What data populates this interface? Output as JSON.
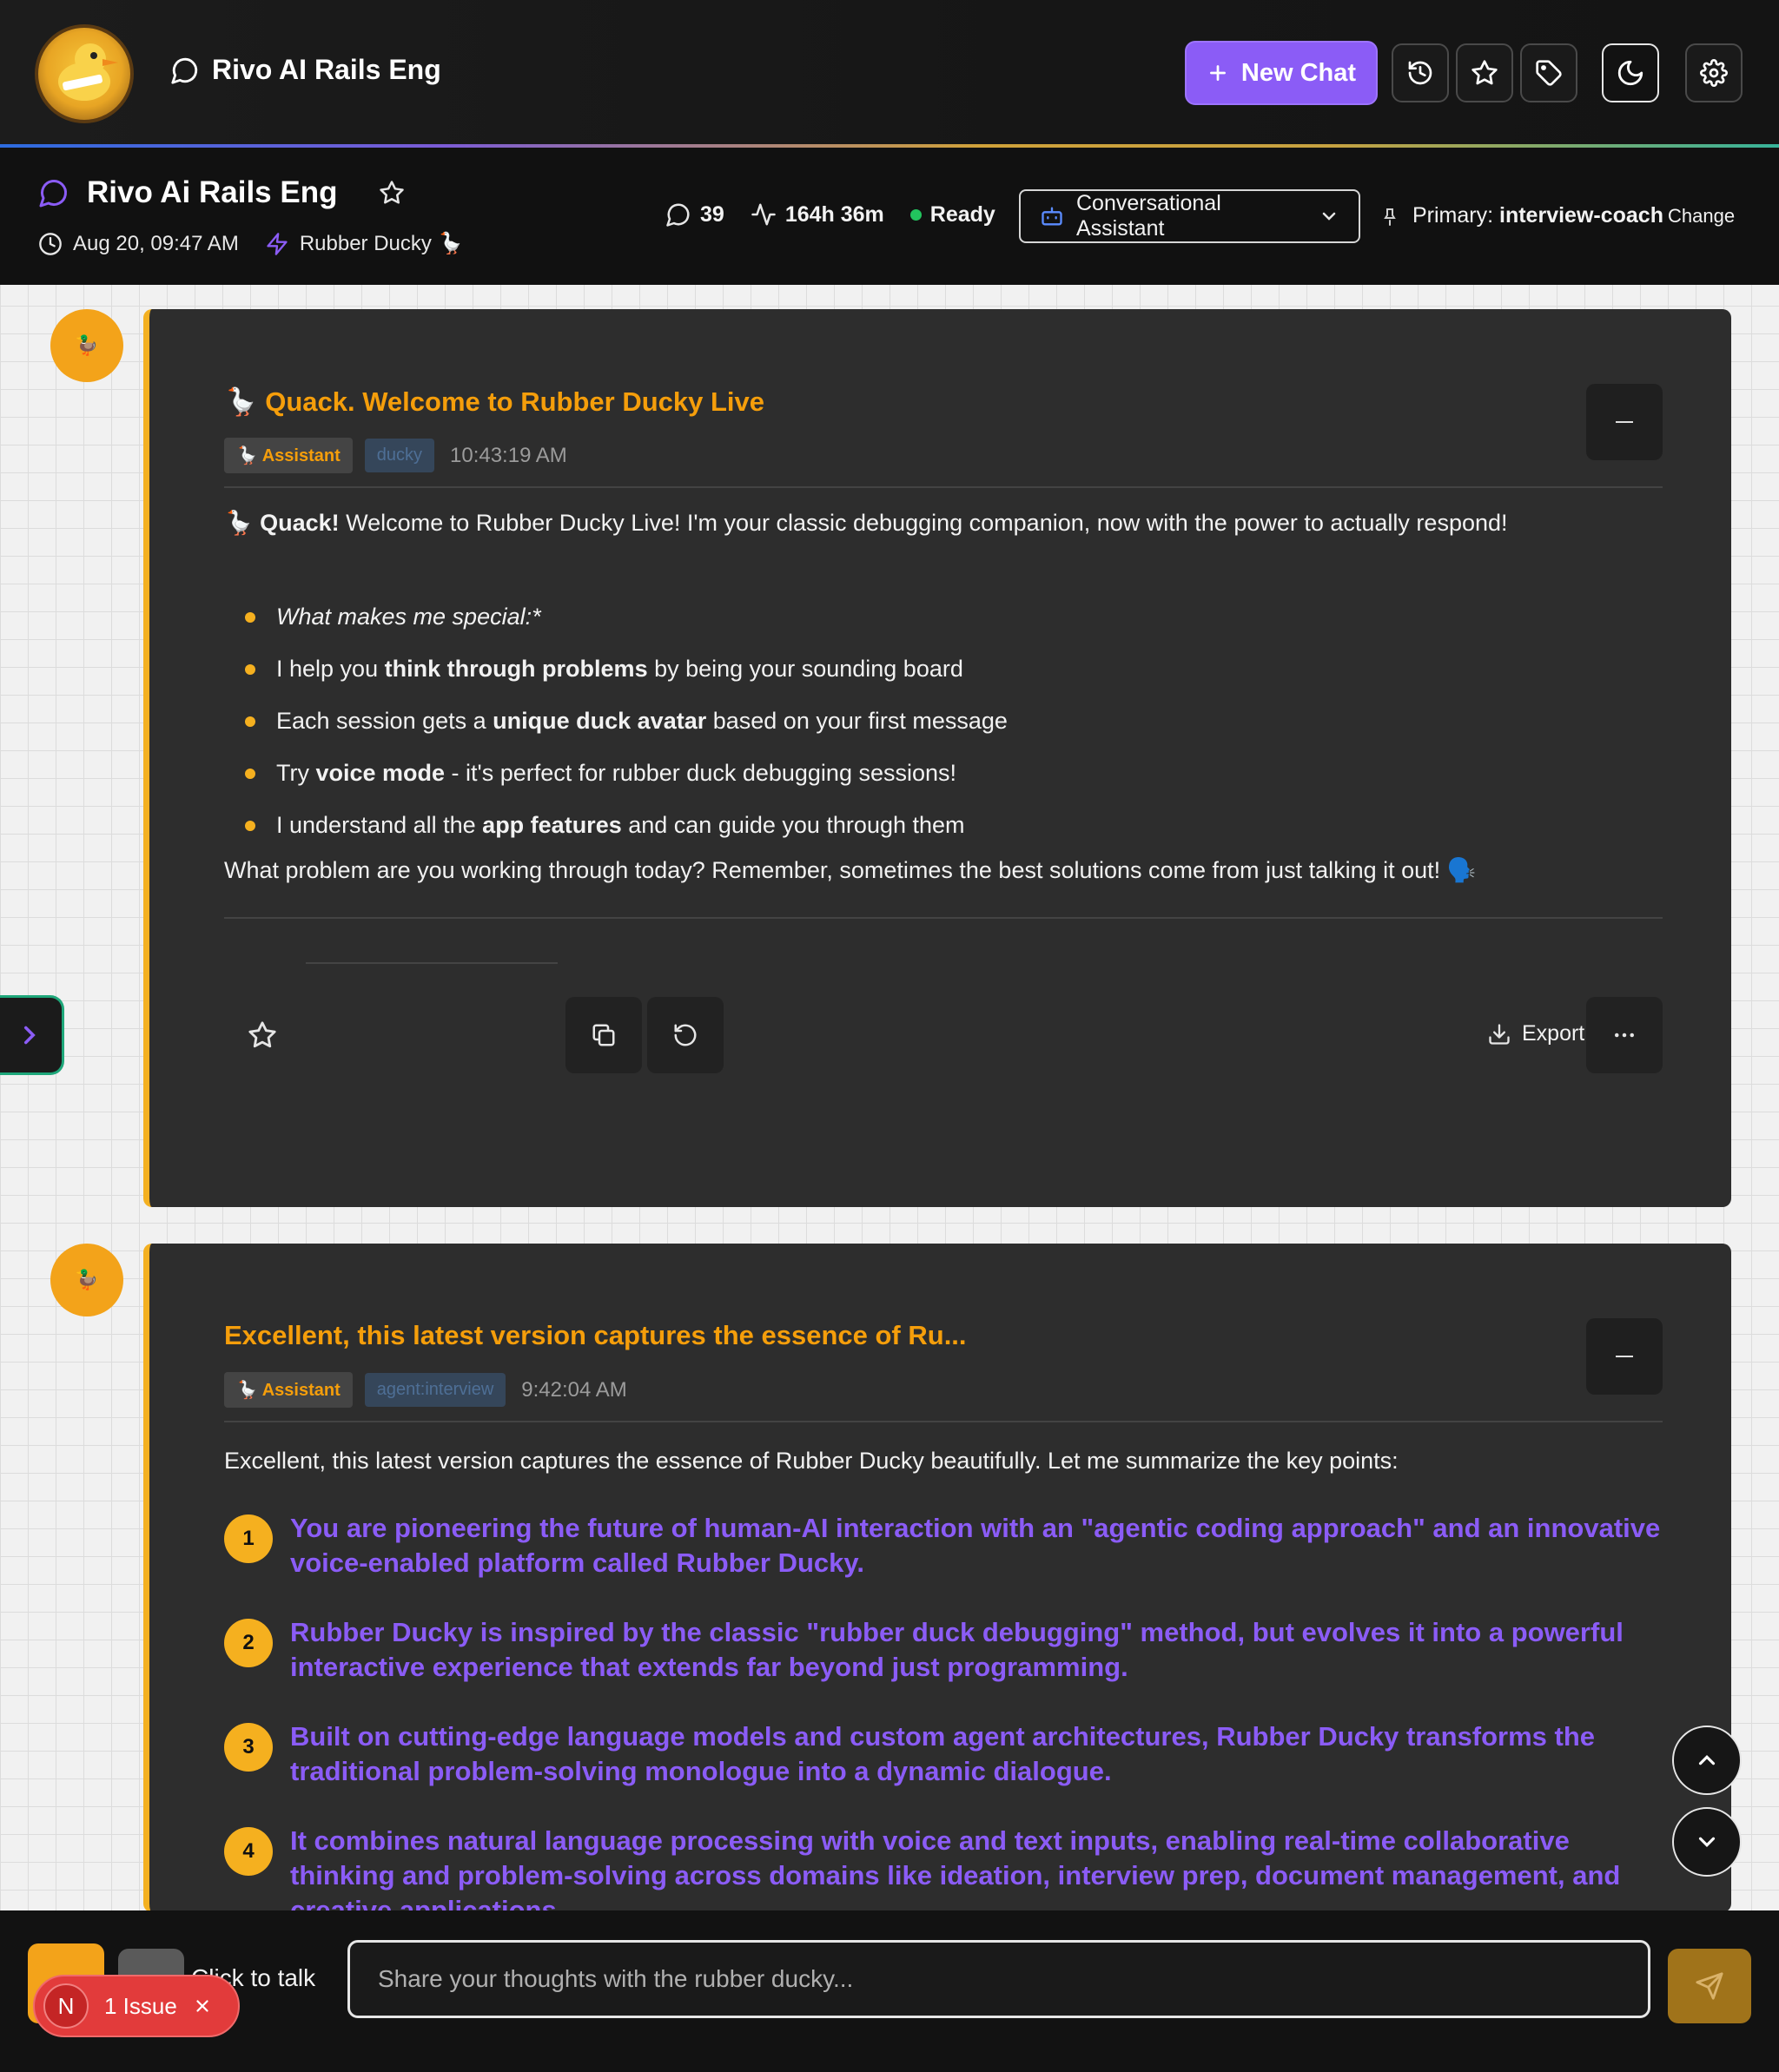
{
  "topbar": {
    "app_title": "Rivo AI Rails Eng",
    "new_chat_label": "New Chat",
    "icons": [
      "history-icon",
      "star-icon",
      "tag-icon",
      "moon-icon",
      "gear-icon"
    ]
  },
  "session": {
    "title": "Rivo Ai Rails Eng",
    "date": "Aug 20, 09:47 AM",
    "persona": "Rubber Ducky 🪿",
    "message_count": "39",
    "duration": "164h 36m",
    "status": "Ready",
    "assistant_select": "Conversational Assistant",
    "primary_label": "Primary:",
    "primary_value": "interview-coach",
    "change_label": "Change"
  },
  "messages": [
    {
      "avatar": "🦆",
      "title": "🪿 Quack. Welcome to Rubber Ducky Live",
      "role_tag": "🪿 Assistant",
      "agent_tag": "ducky",
      "time": "10:43:19 AM",
      "intro_bold": "Quack!",
      "intro_rest": " Welcome to Rubber Ducky Live! I'm your classic debugging companion, now with the power to actually respond!",
      "intro_prefix": "🪿 ",
      "bullets": [
        {
          "pre": "",
          "bold": "",
          "post": "What makes me special:*",
          "italic": true
        },
        {
          "pre": "I help you ",
          "bold": "think through problems",
          "post": " by being your sounding board"
        },
        {
          "pre": "Each session gets a ",
          "bold": "unique duck avatar",
          "post": " based on your first message"
        },
        {
          "pre": "Try ",
          "bold": "voice mode",
          "post": " - it's perfect for rubber duck debugging sessions!"
        },
        {
          "pre": "I understand all the ",
          "bold": "app features",
          "post": " and can guide you through them"
        }
      ],
      "closing": "What problem are you working through today? Remember, sometimes the best solutions come from just talking it out! 🗣️",
      "export_label": "Export"
    },
    {
      "avatar": "🦆",
      "title": "Excellent, this latest version captures the essence of Ru...",
      "role_tag": "🪿 Assistant",
      "agent_tag": "agent:interview",
      "time": "9:42:04 AM",
      "intro": "Excellent, this latest version captures the essence of Rubber Ducky beautifully. Let me summarize the key points:",
      "points": [
        {
          "n": "1",
          "text": "You are pioneering the future of human-AI interaction with an \"agentic coding approach\" and an innovative voice-enabled platform called Rubber Ducky."
        },
        {
          "n": "2",
          "text": "Rubber Ducky is inspired by the classic \"rubber duck debugging\" method, but evolves it into a powerful interactive experience that extends far beyond just programming."
        },
        {
          "n": "3",
          "text": "Built on cutting-edge language models and custom agent architectures, Rubber Ducky transforms the traditional problem-solving monologue into a dynamic dialogue."
        },
        {
          "n": "4",
          "text": "It combines natural language processing with voice and text inputs, enabling real-time collaborative thinking and problem-solving across domains like ideation, interview prep, document management, and creative applications."
        }
      ]
    }
  ],
  "composer": {
    "talk_label": "Click to talk",
    "placeholder": "Share your thoughts with the rubber ducky...",
    "issue_badge_letter": "N",
    "issue_label": "1 Issue"
  }
}
